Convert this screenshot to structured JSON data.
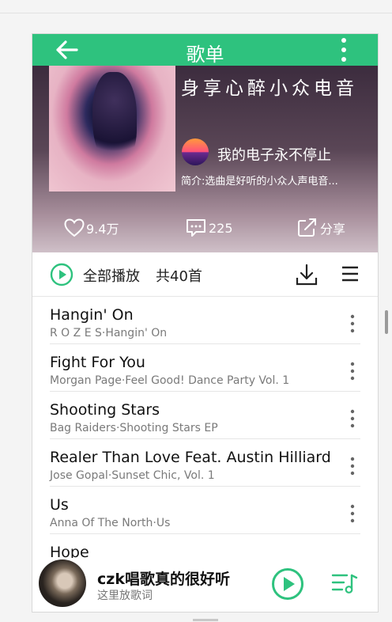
{
  "header": {
    "title": "歌单"
  },
  "playlist": {
    "name": "身享心醉小众电音",
    "author": "我的电子永不停止",
    "intro": "简介:选曲是好听的小众人声电音..."
  },
  "stats": {
    "likes": "9.4万",
    "comments": "225",
    "share": "分享"
  },
  "playbar": {
    "label": "全部播放",
    "count": "共40首"
  },
  "songs": [
    {
      "title": "Hangin' On",
      "subtitle": "R O Z E S·Hangin' On"
    },
    {
      "title": "Fight For You",
      "subtitle": "Morgan Page·Feel Good! Dance Party Vol. 1"
    },
    {
      "title": "Shooting Stars",
      "subtitle": "Bag Raiders·Shooting Stars EP"
    },
    {
      "title": "Realer Than Love Feat. Austin Hilliard",
      "subtitle": "Jose Gopal·Sunset Chic, Vol. 1"
    },
    {
      "title": "Us",
      "subtitle": "Anna Of The North·Us"
    },
    {
      "title": "Hope",
      "subtitle": ""
    }
  ],
  "player": {
    "title": "czk唱歌真的很好听",
    "subtitle": "这里放歌词"
  },
  "colors": {
    "accent": "#2ec27e"
  }
}
